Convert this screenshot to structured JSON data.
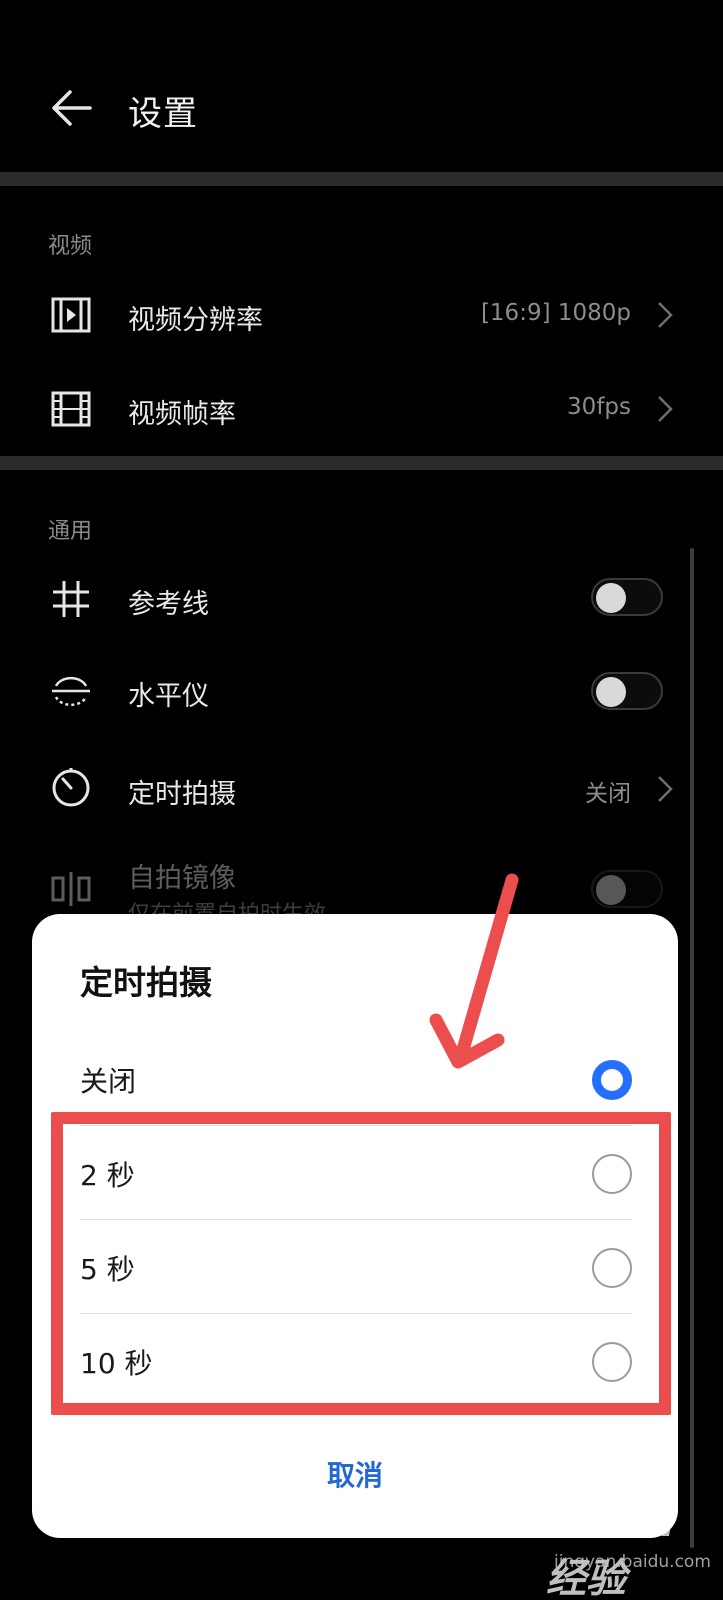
{
  "header": {
    "title": "设置",
    "back_icon": "arrow-left-icon"
  },
  "sections": {
    "video": {
      "label": "视频",
      "items": [
        {
          "label": "视频分辨率",
          "value": "[16:9] 1080p",
          "icon": "video-resolution-icon"
        },
        {
          "label": "视频帧率",
          "value": "30fps",
          "icon": "film-strip-icon"
        }
      ]
    },
    "general": {
      "label": "通用",
      "items": [
        {
          "label": "参考线",
          "toggle": false,
          "icon": "grid-icon"
        },
        {
          "label": "水平仪",
          "toggle": false,
          "icon": "level-icon"
        },
        {
          "label": "定时拍摄",
          "value": "关闭",
          "icon": "timer-icon"
        },
        {
          "label": "自拍镜像",
          "sublabel": "仅在前置自拍时生效",
          "toggle": false,
          "icon": "mirror-icon"
        }
      ]
    }
  },
  "dialog": {
    "title": "定时拍摄",
    "options": [
      {
        "label": "关闭",
        "selected": true
      },
      {
        "label": "2 秒",
        "selected": false
      },
      {
        "label": "5 秒",
        "selected": false
      },
      {
        "label": "10 秒",
        "selected": false
      }
    ],
    "cancel_label": "取消"
  },
  "annotation": {
    "color": "#ec4d4d"
  },
  "accent_color": "#256fff",
  "watermark": {
    "logo": "Baidu经验",
    "url": "jingyan.baidu.com"
  }
}
